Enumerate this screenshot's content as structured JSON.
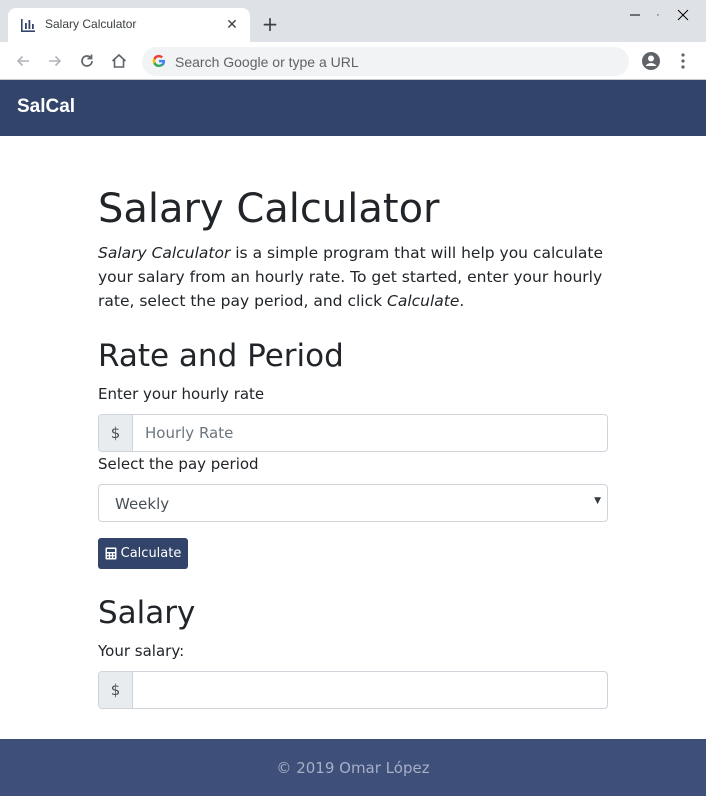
{
  "browser": {
    "tab_title": "Salary Calculator",
    "omnibox_placeholder": "Search Google or type a URL"
  },
  "navbar": {
    "brand": "SalCal"
  },
  "main": {
    "title": "Salary Calculator",
    "intro": {
      "em1": "Salary Calculator",
      "text1": " is a simple program that will help you calculate your salary from an hourly rate. To get started, enter your hourly rate, select the pay period, and click ",
      "em2": "Calculate",
      "text2": "."
    },
    "rate_section": {
      "heading": "Rate and Period",
      "rate_label": "Enter your hourly rate",
      "currency_symbol": "$",
      "rate_placeholder": "Hourly Rate",
      "period_label": "Select the pay period",
      "period_selected": "Weekly",
      "calculate_label": "Calculate"
    },
    "salary_section": {
      "heading": "Salary",
      "salary_label": "Your salary:",
      "currency_symbol": "$",
      "salary_value": ""
    }
  },
  "footer": {
    "copyright": "© 2019 Omar López"
  },
  "colors": {
    "navbar": "#33446b",
    "footer": "#3e4f7a",
    "button": "#33446b"
  },
  "icons": [
    "bar-chart-favicon",
    "close-icon",
    "plus-icon",
    "minimize-icon",
    "maximize-icon",
    "window-close-icon",
    "back-arrow-icon",
    "forward-arrow-icon",
    "reload-icon",
    "home-icon",
    "google-icon",
    "profile-icon",
    "kebab-menu-icon",
    "calculator-icon",
    "chevron-down-icon"
  ]
}
